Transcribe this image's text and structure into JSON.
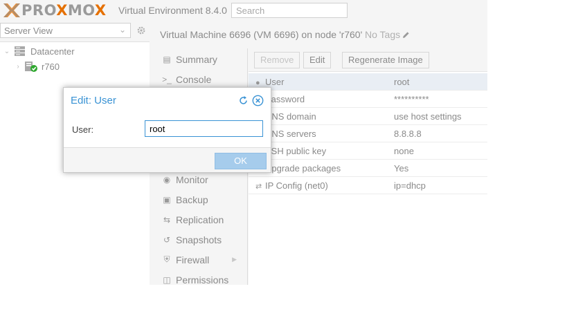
{
  "header": {
    "logo_text": "PROXMOX",
    "product": "Virtual Environment 8.4.0",
    "search_placeholder": "Search"
  },
  "sidebar": {
    "view_select": "Server View",
    "tree": [
      {
        "label": "Datacenter",
        "icon": "server-stack-icon"
      },
      {
        "label": "r760",
        "icon": "node-online-icon"
      }
    ]
  },
  "vm": {
    "title": "Virtual Machine 6696 (VM 6696) on node 'r760'",
    "tags": "No Tags"
  },
  "nav": {
    "items": [
      {
        "label": "Summary",
        "icon": "book-icon"
      },
      {
        "label": "Console",
        "icon": "terminal-icon"
      },
      {
        "label": "Monitor",
        "icon": "eye-icon"
      },
      {
        "label": "Backup",
        "icon": "floppy-icon"
      },
      {
        "label": "Replication",
        "icon": "retweet-icon"
      },
      {
        "label": "Snapshots",
        "icon": "history-icon"
      },
      {
        "label": "Firewall",
        "icon": "shield-icon"
      },
      {
        "label": "Permissions",
        "icon": "unlock-icon"
      }
    ]
  },
  "toolbar": {
    "remove_label": "Remove",
    "edit_label": "Edit",
    "regenerate_label": "Regenerate Image"
  },
  "cloudinit": {
    "rows": [
      {
        "key": "User",
        "value": "root",
        "icon": "user-icon"
      },
      {
        "key": "Password",
        "value": "**********",
        "icon": "none"
      },
      {
        "key": "DNS domain",
        "value": "use host settings",
        "icon": "none"
      },
      {
        "key": "DNS servers",
        "value": "8.8.8.8",
        "icon": "none"
      },
      {
        "key": "SSH public key",
        "value": "none",
        "icon": "none"
      },
      {
        "key": "Upgrade packages",
        "value": "Yes",
        "icon": "none"
      },
      {
        "key": "IP Config (net0)",
        "value": "ip=dhcp",
        "icon": "exchange-icon"
      }
    ]
  },
  "dialog": {
    "title": "Edit: User",
    "field_label": "User:",
    "field_value": "root",
    "ok_label": "OK"
  },
  "colors": {
    "accent": "#3892d4",
    "logo_x": "#e57000",
    "ok_button": "#a6ccec",
    "online": "#2fa82f"
  }
}
